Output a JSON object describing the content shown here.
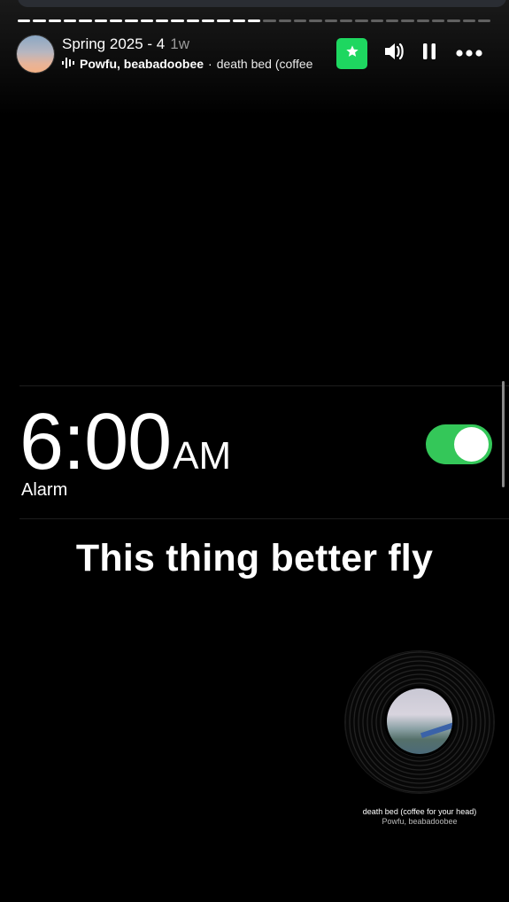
{
  "header": {
    "title": "Spring 2025 - 4",
    "age": "1w",
    "music": {
      "artist": "Powfu, beabadoobee",
      "separator": "·",
      "track": "death bed (coffee"
    },
    "progress": {
      "segments": 31,
      "completed": 16
    }
  },
  "controls": {
    "favorite_icon": "star-icon",
    "volume_icon": "speaker-icon",
    "pause_icon": "pause-icon",
    "more_icon": "more-dots-icon"
  },
  "alarm": {
    "hours": "6",
    "colon": ":",
    "minutes": "00",
    "ampm": "AM",
    "label": "Alarm",
    "enabled": true
  },
  "caption": "This thing better fly",
  "sticker": {
    "song_title": "death bed (coffee for your head)",
    "song_artist": "Powfu, beabadoobee"
  },
  "colors": {
    "favorite_bg": "#1ed760",
    "toggle_on": "#34c759"
  }
}
